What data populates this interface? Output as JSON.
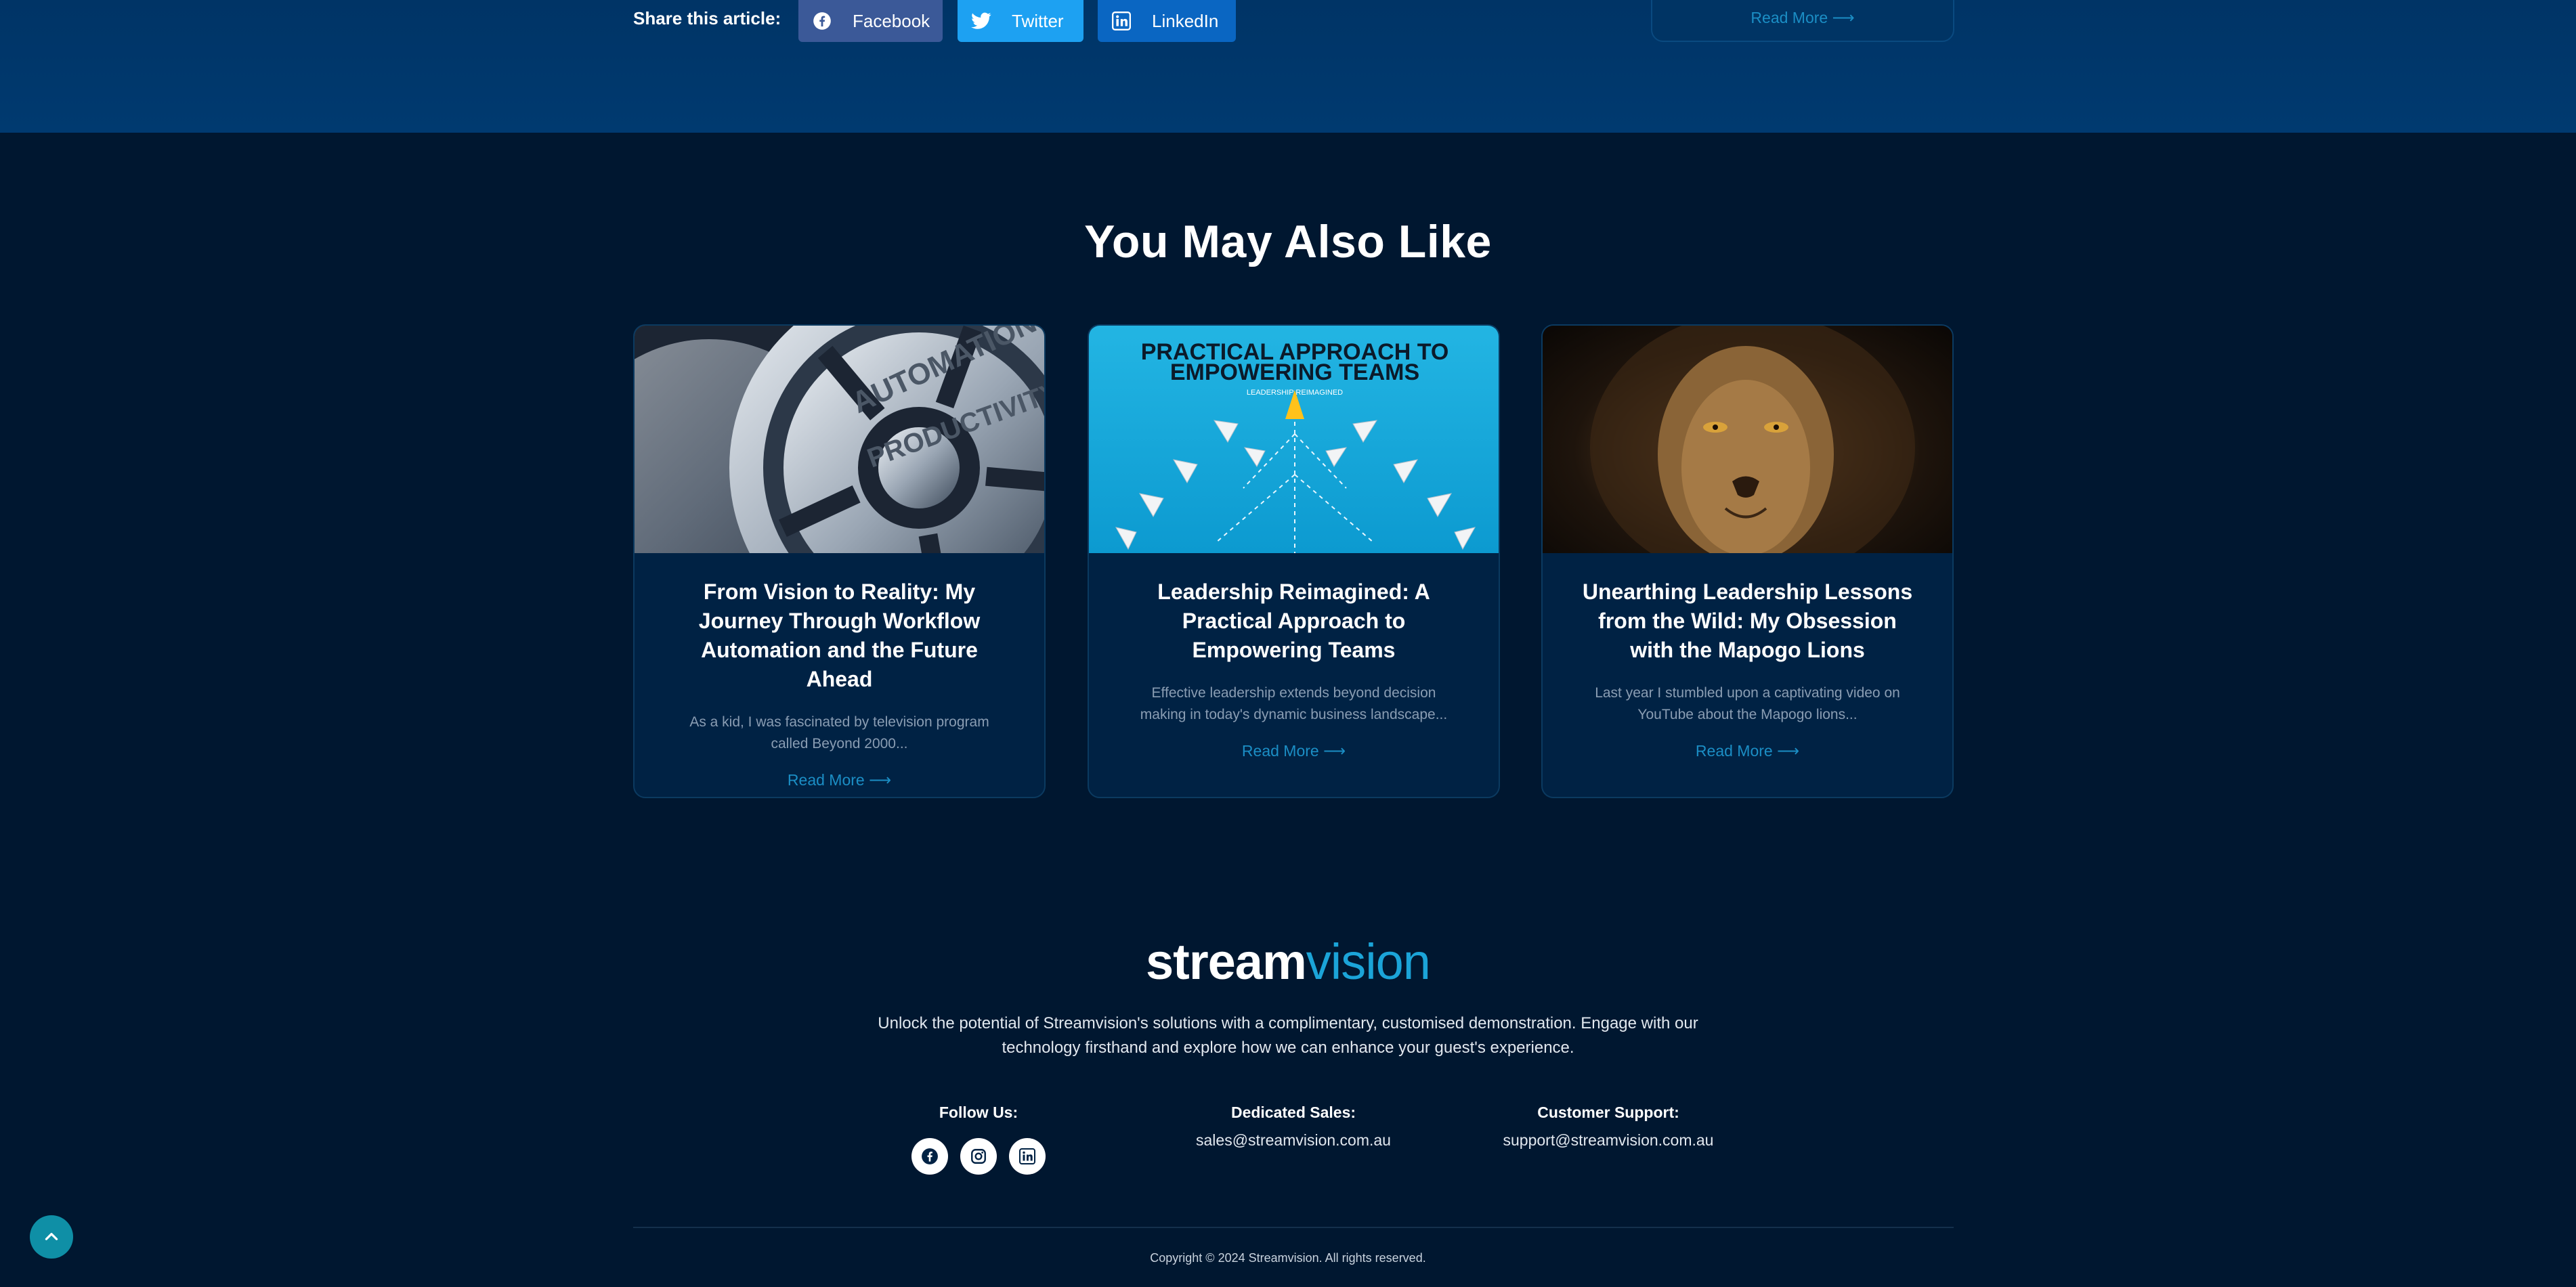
{
  "share": {
    "label": "Share this article:",
    "buttons": [
      {
        "label": "Facebook",
        "icon": "facebook-icon",
        "color": "#3b5998"
      },
      {
        "label": "Twitter",
        "icon": "twitter-icon",
        "color": "#1da1f2"
      },
      {
        "label": "LinkedIn",
        "icon": "linkedin-icon",
        "color": "#0a66c2"
      }
    ],
    "prev_card_read_more": "Read More"
  },
  "related": {
    "title": "You May Also Like",
    "cards": [
      {
        "image": "automation-productivity-gears",
        "image_text": [
          "AUTOMATION",
          "PRODUCTIVITY"
        ],
        "title": "From Vision to Reality: My Journey Through Workflow Automation and the Future Ahead",
        "excerpt": "As a kid, I was fascinated by television program called Beyond 2000...",
        "read_more": "Read More"
      },
      {
        "image": "paper-planes-teams",
        "image_text": [
          "PRACTICAL APPROACH TO",
          "EMPOWERING TEAMS",
          "LEADERSHIP REIMAGINED"
        ],
        "title": "Leadership Reimagined: A Practical Approach to Empowering Teams",
        "excerpt": "Effective leadership extends beyond decision making in today's dynamic business landscape...",
        "read_more": "Read More"
      },
      {
        "image": "lion-portrait",
        "title": "Unearthing Leadership Lessons from the Wild: My Obsession with the Mapogo Lions",
        "excerpt": "Last year I stumbled upon a captivating video on YouTube about the Mapogo lions...",
        "read_more": "Read More"
      }
    ]
  },
  "footer": {
    "logo_part1": "stream",
    "logo_part2": "vision",
    "tagline": "Unlock the potential of Streamvision's solutions with a complimentary, customised demonstration. Engage with our technology firsthand and explore how we can enhance your guest's experience.",
    "follow_label": "Follow Us:",
    "socials": [
      "facebook-icon",
      "instagram-icon",
      "linkedin-icon"
    ],
    "sales_label": "Dedicated Sales:",
    "sales_email": "sales@streamvision.com.au",
    "support_label": "Customer Support:",
    "support_email": "support@streamvision.com.au",
    "copyright": "Copyright © 2024 Streamvision. All rights reserved."
  },
  "colors": {
    "accent": "#1ba4d8",
    "link": "#1b8ec5",
    "background": "#001730",
    "card": "#002244"
  }
}
